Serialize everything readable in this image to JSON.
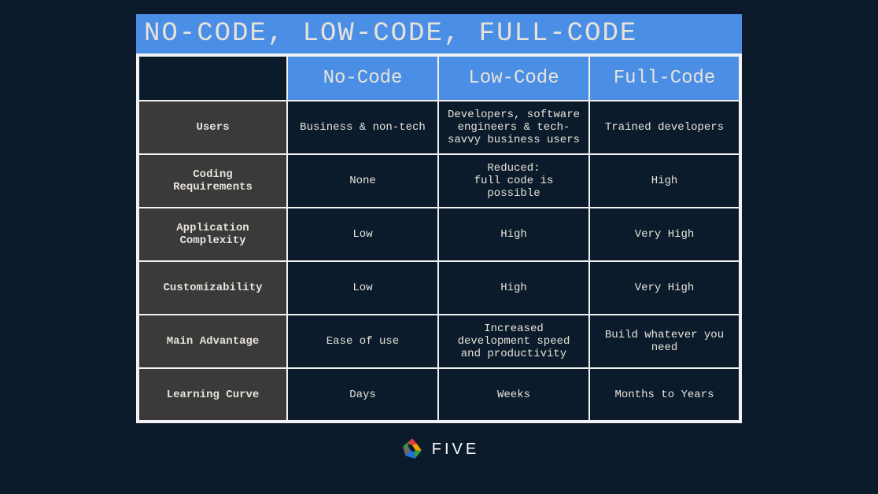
{
  "title": "NO-CODE, LOW-CODE, FULL-CODE",
  "columns": [
    "No-Code",
    "Low-Code",
    "Full-Code"
  ],
  "rows": [
    {
      "label": "Users",
      "cells": [
        "Business & non-tech",
        "Developers, software engineers & tech-savvy business users",
        "Trained developers"
      ]
    },
    {
      "label": "Coding\nRequirements",
      "cells": [
        "None",
        "Reduced:\nfull code is possible",
        "High"
      ]
    },
    {
      "label": "Application\nComplexity",
      "cells": [
        "Low",
        "High",
        "Very High"
      ]
    },
    {
      "label": "Customizability",
      "cells": [
        "Low",
        "High",
        "Very High"
      ]
    },
    {
      "label": "Main Advantage",
      "cells": [
        "Ease of use",
        "Increased development speed and productivity",
        "Build whatever you need"
      ]
    },
    {
      "label": "Learning Curve",
      "cells": [
        "Days",
        "Weeks",
        "Months to Years"
      ]
    }
  ],
  "logo": {
    "text": "FIVE"
  },
  "colors": {
    "bg": "#0b1b2b",
    "accent": "#4a8ee6",
    "rowlabel": "#3a3a3a",
    "border": "#f2f2f2",
    "text": "#e7e3da"
  },
  "chart_data": {
    "type": "table",
    "title": "NO-CODE, LOW-CODE, FULL-CODE",
    "columns": [
      "",
      "No-Code",
      "Low-Code",
      "Full-Code"
    ],
    "rows": [
      [
        "Users",
        "Business & non-tech",
        "Developers, software engineers & tech-savvy business users",
        "Trained developers"
      ],
      [
        "Coding Requirements",
        "None",
        "Reduced: full code is possible",
        "High"
      ],
      [
        "Application Complexity",
        "Low",
        "High",
        "Very High"
      ],
      [
        "Customizability",
        "Low",
        "High",
        "Very High"
      ],
      [
        "Main Advantage",
        "Ease of use",
        "Increased development speed and productivity",
        "Build whatever you need"
      ],
      [
        "Learning Curve",
        "Days",
        "Weeks",
        "Months to Years"
      ]
    ]
  }
}
